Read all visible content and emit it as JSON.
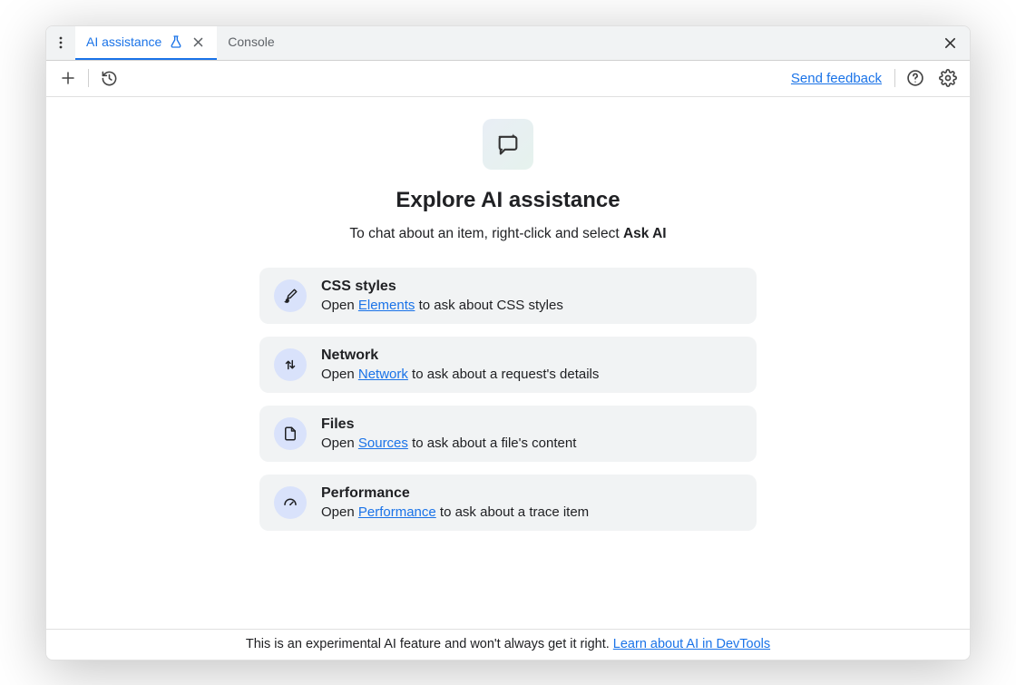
{
  "tabs": [
    {
      "label": "AI assistance",
      "active": true
    },
    {
      "label": "Console",
      "active": false
    }
  ],
  "toolbar": {
    "feedback_label": "Send feedback"
  },
  "hero": {
    "title": "Explore AI assistance",
    "subtitle_prefix": "To chat about an item, right-click and select ",
    "subtitle_bold": "Ask AI"
  },
  "cards": [
    {
      "icon": "brush",
      "title": "CSS styles",
      "prefix": "Open ",
      "link": "Elements",
      "suffix": " to ask about CSS styles"
    },
    {
      "icon": "transfer",
      "title": "Network",
      "prefix": "Open ",
      "link": "Network",
      "suffix": " to ask about a request's details"
    },
    {
      "icon": "file",
      "title": "Files",
      "prefix": "Open ",
      "link": "Sources",
      "suffix": " to ask about a file's content"
    },
    {
      "icon": "gauge",
      "title": "Performance",
      "prefix": "Open ",
      "link": "Performance",
      "suffix": " to ask about a trace item"
    }
  ],
  "footer": {
    "text": "This is an experimental AI feature and won't always get it right.",
    "link": "Learn about AI in DevTools"
  }
}
